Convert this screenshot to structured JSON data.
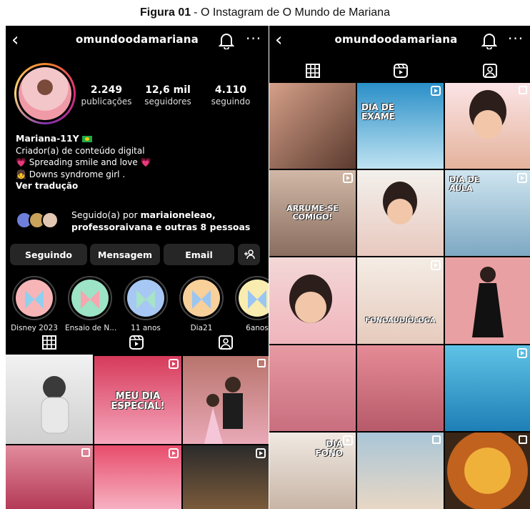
{
  "caption": {
    "bold": "Figura 01",
    "rest": "- O Instagram de O Mundo de Mariana"
  },
  "left": {
    "username": "omundoodamariana",
    "stats": [
      {
        "num": "2.249",
        "label": "publicações"
      },
      {
        "num": "12,6 mil",
        "label": "seguidores"
      },
      {
        "num": "4.110",
        "label": "seguindo"
      }
    ],
    "bio": {
      "name": "Mariana-11Y",
      "line1": "Criador(a) de conteúdo digital",
      "line2": "💗 Spreading smile and love 💗",
      "line3": "👧 Downs syndrome girl .",
      "translate": "Ver tradução"
    },
    "followed_by": {
      "prefix": "Seguido(a) por",
      "user1": "mariaioneleao,",
      "user2": "professoraivana",
      "suffix": "e outras 8 pessoas"
    },
    "buttons": {
      "following": "Seguindo",
      "message": "Mensagem",
      "email": "Email",
      "add_icon": "+🅰"
    },
    "highlights": [
      "Disney 2023",
      "Ensaio de N...",
      "11 anos",
      "Dia21",
      "6anos"
    ],
    "grid_texts": {
      "t2": "MEU DIA ESPECIAL!"
    }
  },
  "right": {
    "username": "omundoodamariana",
    "grid_texts": {
      "r1c2": "DIA DE EXAME",
      "r2c1": "ARRUME-SE COMIGO!",
      "r2c3": "DIA DE AULA",
      "r3c2": "FONOAUDIÓLOGA",
      "r5c1": "DIA FONO"
    }
  },
  "colors": {
    "bg": "#000000",
    "button": "#262626",
    "text": "#ffffff"
  }
}
